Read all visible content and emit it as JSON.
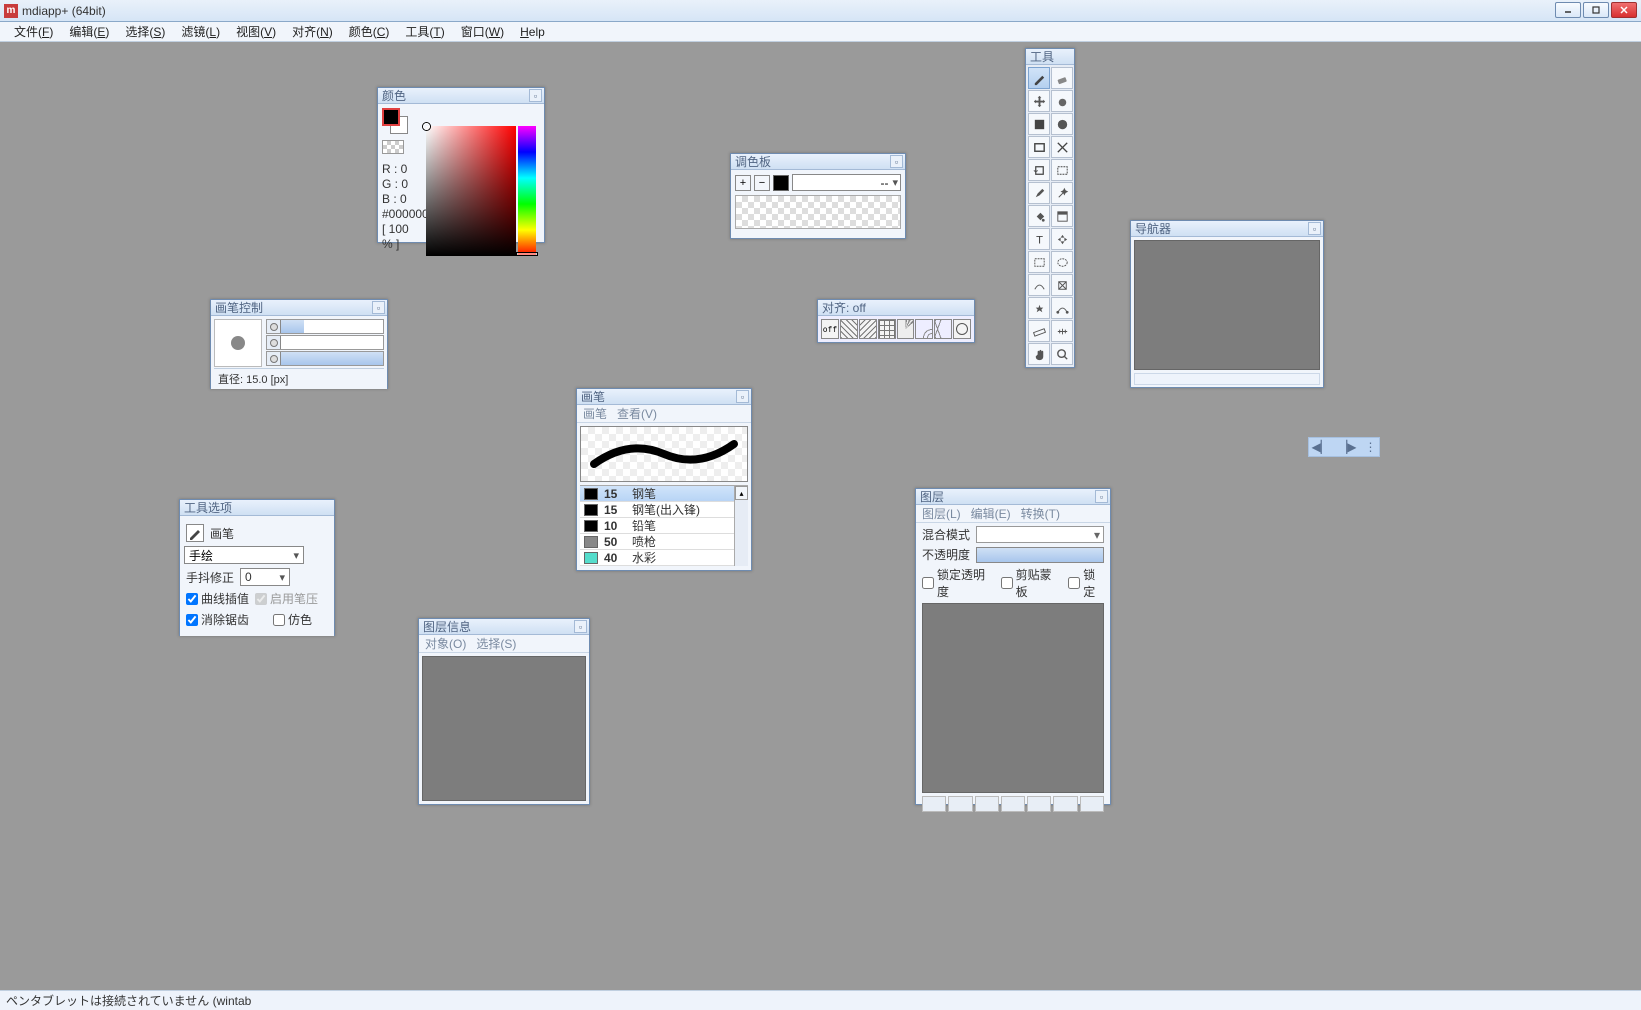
{
  "app": {
    "icon_letter": "m",
    "title": "mdiapp+ (64bit)"
  },
  "menus": [
    "文件(<u>F</u>)",
    "编辑(<u>E</u>)",
    "选择(<u>S</u>)",
    "滤镜(<u>L</u>)",
    "视图(<u>V</u>)",
    "对齐(<u>N</u>)",
    "颜色(<u>C</u>)",
    "工具(<u>T</u>)",
    "窗口(<u>W</u>)",
    "<u>H</u>elp"
  ],
  "status": "ペンタブレットは接続されていません (wintab",
  "color_panel": {
    "title": "颜色",
    "r": "R : 0",
    "g": "G : 0",
    "b": "B : 0",
    "hex": "#000000",
    "pct": "[ 100 % ]"
  },
  "palette_panel": {
    "title": "调色板",
    "select_value": "--"
  },
  "brushctl_panel": {
    "title": "画笔控制",
    "status": "直径: 15.0 [px]",
    "slider_fills": [
      20,
      0,
      100
    ]
  },
  "snap_panel": {
    "title": "对齐: off",
    "off_label": "off"
  },
  "brush_panel": {
    "title": "画笔",
    "menu": [
      "画笔",
      "查看(V)"
    ],
    "brushes": [
      {
        "sz": "15",
        "nm": "钢笔",
        "sw": "#000",
        "sel": true,
        "gear": true
      },
      {
        "sz": "15",
        "nm": "钢笔(出入锋)",
        "sw": "#000"
      },
      {
        "sz": "10",
        "nm": "铅笔",
        "sw": "#000"
      },
      {
        "sz": "50",
        "nm": "喷枪",
        "sw": "#888"
      },
      {
        "sz": "40",
        "nm": "水彩",
        "sw": "#5dc"
      }
    ]
  },
  "toolopt_panel": {
    "title": "工具选项",
    "current_tool": "画笔",
    "mode": "手绘",
    "stabilize_label": "手抖修正",
    "stabilize_value": "0",
    "cb_curve": "曲线插值",
    "cb_pressure": "启用笔压",
    "cb_aa": "消除锯齿",
    "cb_dither": "仿色",
    "curve_on": true,
    "pressure_on": true,
    "aa_on": true,
    "dither_on": false
  },
  "layerinfo_panel": {
    "title": "图层信息",
    "menu": [
      "对象(O)",
      "选择(S)"
    ]
  },
  "layers_panel": {
    "title": "图层",
    "menu": [
      "图层(L)",
      "编辑(E)",
      "转换(T)"
    ],
    "blend_label": "混合模式",
    "opacity_label": "不透明度",
    "cb_lock_alpha": "锁定透明度",
    "cb_clip": "剪贴蒙板",
    "cb_lock": "锁定"
  },
  "nav_panel": {
    "title": "导航器"
  },
  "toolbox": {
    "title": "工具",
    "tools": [
      "pen",
      "eraser",
      "move",
      "blur",
      "fill",
      "gradient",
      "shape-rect",
      "shape-line",
      "select-rect",
      "select-free",
      "eyedropper",
      "magic-wand",
      "bucket",
      "panel",
      "text",
      "transform",
      "marquee-rect",
      "marquee-ellipse",
      "special-a",
      "special-b",
      "special-c",
      "edit-path",
      "ruler",
      "guide",
      "hand",
      "zoom"
    ],
    "selected": 0
  },
  "frame_pill": {
    "prev": "◀▏",
    "next": "▕▶",
    "menu": "⋮"
  }
}
